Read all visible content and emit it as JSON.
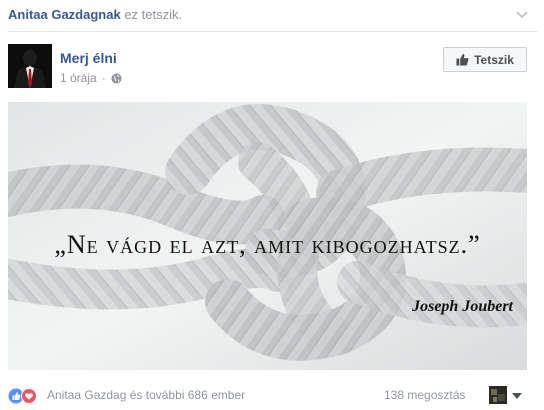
{
  "liker": {
    "name": "Anitaa Gazdagnak",
    "action": "ez tetszik."
  },
  "post": {
    "page_name": "Merj élni",
    "time": "1 órája",
    "separator": "·",
    "like_button": "Tetszik",
    "image": {
      "quote": "„Ne vágd el azt, amit kibogozhatsz.”",
      "author": "Joseph Joubert"
    }
  },
  "footer": {
    "reactors": "Anitaa Gazdag és további 686 ember",
    "shares": "138 megosztás"
  },
  "colors": {
    "link": "#365899",
    "muted": "#90949c",
    "like_blue": "#5890ff",
    "love_red": "#f25268"
  },
  "icons": [
    "chevron-down-icon",
    "globe-icon",
    "thumbs-up-icon",
    "like-reaction-icon",
    "love-reaction-icon"
  ]
}
